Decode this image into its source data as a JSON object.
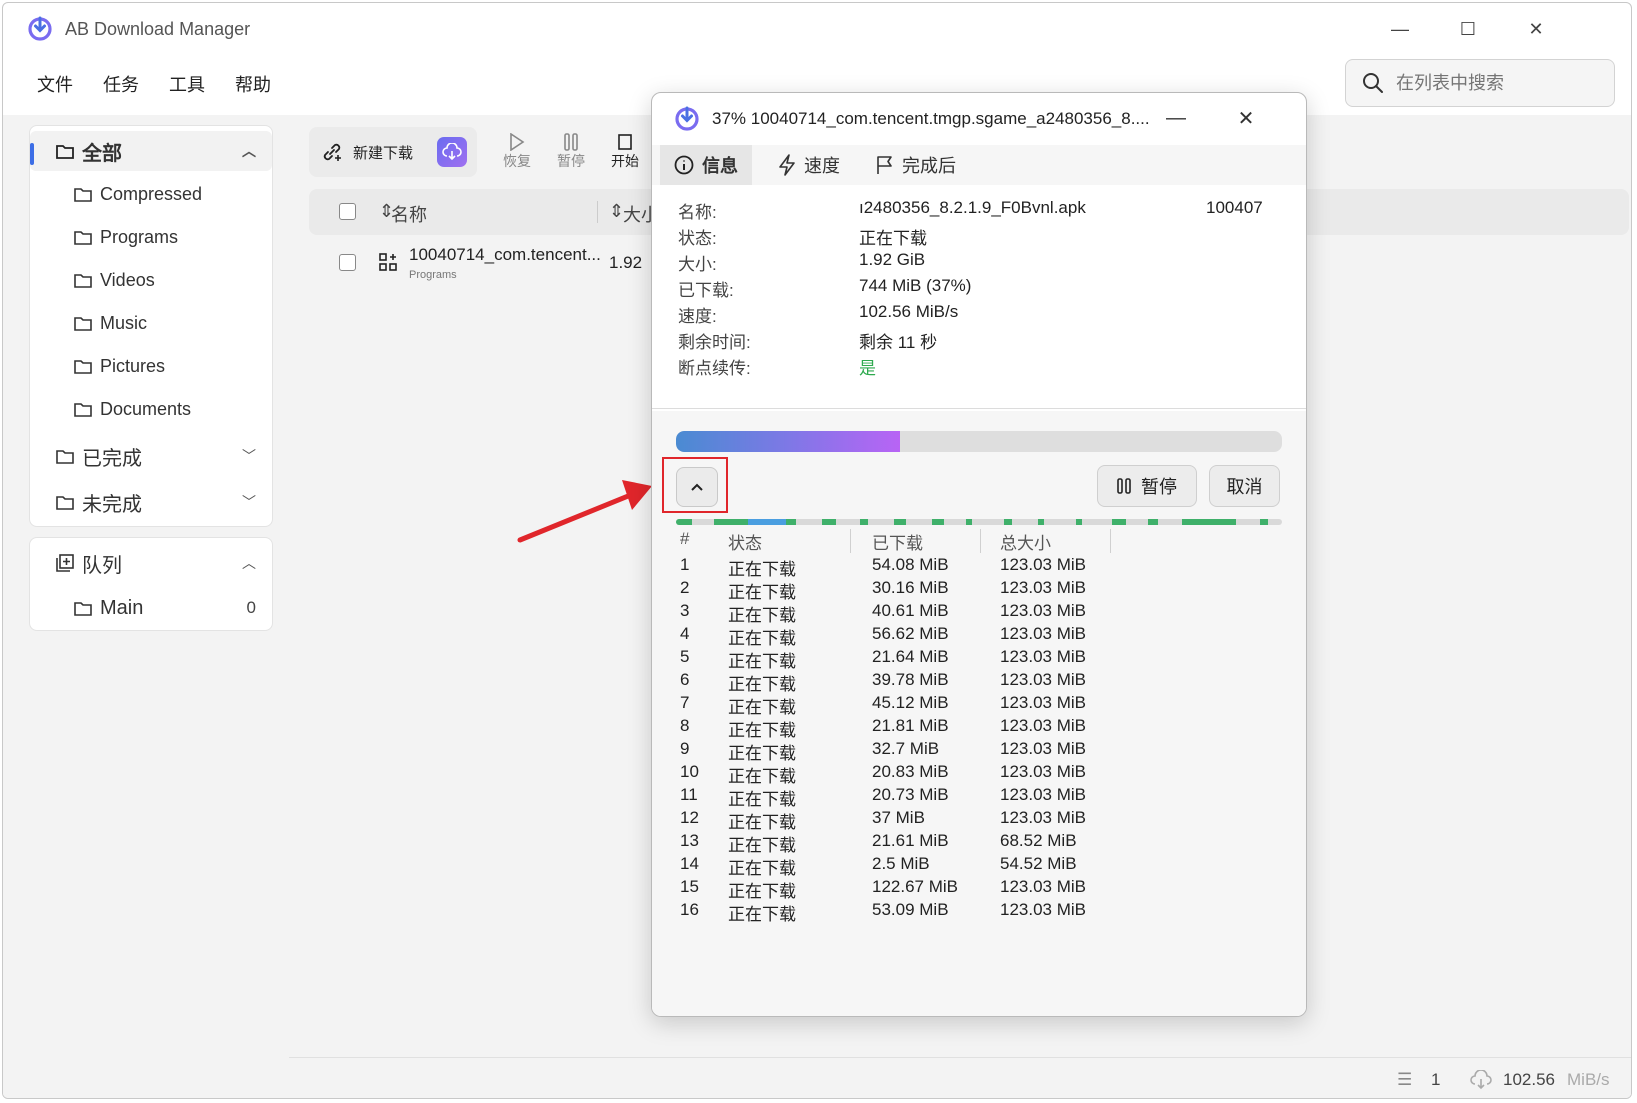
{
  "app": {
    "title": "AB Download Manager",
    "minimize": "—",
    "maximize": "☐",
    "close": "✕"
  },
  "menu": [
    "文件",
    "任务",
    "工具",
    "帮助"
  ],
  "search": {
    "placeholder": "在列表中搜索"
  },
  "sidebar": {
    "all": "全部",
    "categories": [
      "Compressed",
      "Programs",
      "Videos",
      "Music",
      "Pictures",
      "Documents"
    ],
    "completed": "已完成",
    "unfinished": "未完成",
    "queue": "队列",
    "queues": [
      {
        "name": "Main",
        "count": "0"
      }
    ]
  },
  "toolbar": {
    "new_download": "新建下载",
    "resume": "恢复",
    "pause": "暂停",
    "start": "开始"
  },
  "list": {
    "headers": {
      "name": "名称",
      "size": "大小"
    },
    "rows": [
      {
        "name": "10040714_com.tencent...",
        "category": "Programs",
        "size": "1.92"
      }
    ]
  },
  "statusbar": {
    "count": "1",
    "speed": "102.56",
    "unit": "MiB/s"
  },
  "dialog": {
    "title": "37% 10040714_com.tencent.tmgp.sgame_a2480356_8....",
    "tabs": {
      "info": "信息",
      "speed": "速度",
      "after": "完成后"
    },
    "info": {
      "name_label": "名称:",
      "name_value": "ı2480356_8.2.1.9_F0Bvnl.apk",
      "name_value_right": "100407",
      "status_label": "状态:",
      "status_value": "正在下载",
      "size_label": "大小:",
      "size_value": "1.92 GiB",
      "downloaded_label": "已下载:",
      "downloaded_value": "744 MiB (37%)",
      "speed_label": "速度:",
      "speed_value": "102.56 MiB/s",
      "remaining_label": "剩余时间:",
      "remaining_value": "剩余 11 秒",
      "resume_label": "断点续传:",
      "resume_value": "是"
    },
    "progress": 0.37,
    "accent_color": "#b864f5",
    "resume_color": "#2faa4f",
    "pause_label": "暂停",
    "cancel_label": "取消",
    "parts_headers": {
      "num": "#",
      "status": "状态",
      "downloaded": "已下载",
      "total": "总大小"
    },
    "parts": [
      {
        "n": "1",
        "status": "正在下载",
        "downloaded": "54.08 MiB",
        "total": "123.03 MiB"
      },
      {
        "n": "2",
        "status": "正在下载",
        "downloaded": "30.16 MiB",
        "total": "123.03 MiB"
      },
      {
        "n": "3",
        "status": "正在下载",
        "downloaded": "40.61 MiB",
        "total": "123.03 MiB"
      },
      {
        "n": "4",
        "status": "正在下载",
        "downloaded": "56.62 MiB",
        "total": "123.03 MiB"
      },
      {
        "n": "5",
        "status": "正在下载",
        "downloaded": "21.64 MiB",
        "total": "123.03 MiB"
      },
      {
        "n": "6",
        "status": "正在下载",
        "downloaded": "39.78 MiB",
        "total": "123.03 MiB"
      },
      {
        "n": "7",
        "status": "正在下载",
        "downloaded": "45.12 MiB",
        "total": "123.03 MiB"
      },
      {
        "n": "8",
        "status": "正在下载",
        "downloaded": "21.81 MiB",
        "total": "123.03 MiB"
      },
      {
        "n": "9",
        "status": "正在下载",
        "downloaded": "32.7 MiB",
        "total": "123.03 MiB"
      },
      {
        "n": "10",
        "status": "正在下载",
        "downloaded": "20.83 MiB",
        "total": "123.03 MiB"
      },
      {
        "n": "11",
        "status": "正在下载",
        "downloaded": "20.73 MiB",
        "total": "123.03 MiB"
      },
      {
        "n": "12",
        "status": "正在下载",
        "downloaded": "37 MiB",
        "total": "123.03 MiB"
      },
      {
        "n": "13",
        "status": "正在下载",
        "downloaded": "21.61 MiB",
        "total": "68.52 MiB"
      },
      {
        "n": "14",
        "status": "正在下载",
        "downloaded": "2.5 MiB",
        "total": "54.52 MiB"
      },
      {
        "n": "15",
        "status": "正在下载",
        "downloaded": "122.67 MiB",
        "total": "123.03 MiB"
      },
      {
        "n": "16",
        "status": "正在下载",
        "downloaded": "53.09 MiB",
        "total": "123.03 MiB"
      }
    ]
  }
}
